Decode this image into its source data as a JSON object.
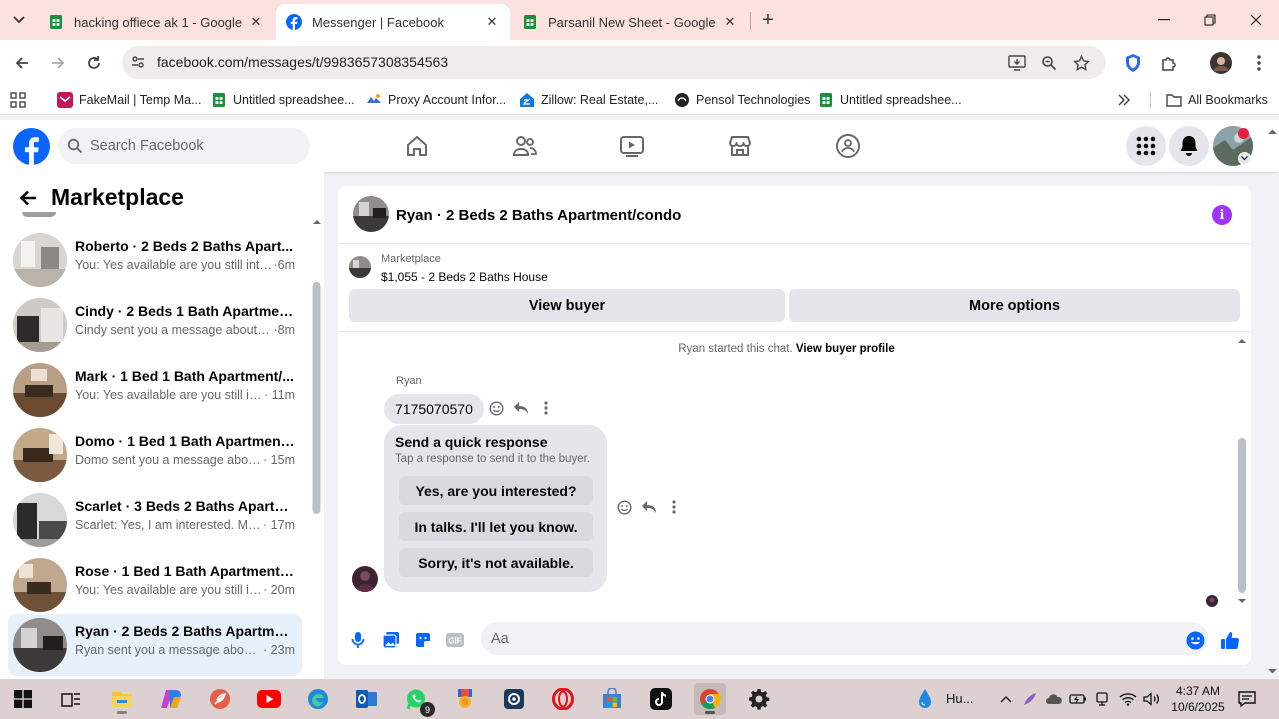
{
  "browser": {
    "tabs": [
      {
        "title": "hacking offiece ak 1 - Google Sh",
        "icon": "google-sheets-icon"
      },
      {
        "title": "Messenger | Facebook",
        "icon": "facebook-icon",
        "active": true
      },
      {
        "title": "Parsanil New Sheet - Google Sh",
        "icon": "google-sheets-icon"
      }
    ],
    "url": "facebook.com/messages/t/9983657308354563",
    "bookmarks": [
      {
        "label": "FakeMail | Temp Ma...",
        "icon": "fakemail-icon"
      },
      {
        "label": "Untitled spreadshee...",
        "icon": "google-sheets-icon"
      },
      {
        "label": "Proxy Account Infor...",
        "icon": "proxy-icon"
      },
      {
        "label": "Zillow: Real Estate,...",
        "icon": "zillow-icon"
      },
      {
        "label": "Pensol Technologies",
        "icon": "pensol-icon"
      },
      {
        "label": "Untitled spreadshee...",
        "icon": "google-sheets-icon"
      }
    ],
    "all_bookmarks": "All Bookmarks"
  },
  "facebook": {
    "search_placeholder": "Search Facebook"
  },
  "marketplace": {
    "title": "Marketplace",
    "conversations": [
      {
        "name": "Roberto · 2 Beds 2 Baths Apart...",
        "preview": "You: Yes available are you still inter...",
        "time": "·6m"
      },
      {
        "name": "Cindy · 2 Beds 1 Bath Apartment...",
        "preview": "Cindy sent you a message about y...",
        "time": "·8m"
      },
      {
        "name": "Mark · 1 Bed 1 Bath Apartment/...",
        "preview": "You: Yes available are you still int...",
        "time": "· 11m"
      },
      {
        "name": "Domo · 1 Bed 1 Bath Apartment...",
        "preview": "Domo sent you a message about...",
        "time": "· 15m"
      },
      {
        "name": "Scarlet · 3 Beds 2 Baths Apartm...",
        "preview": "Scarlet: Yes, I am interested. My n...",
        "time": "· 17m"
      },
      {
        "name": "Rose · 1 Bed 1 Bath Apartment/c...",
        "preview": "You: Yes available are you still int...",
        "time": "· 20m"
      },
      {
        "name": "Ryan · 2 Beds 2 Baths Apartmen...",
        "preview": "Ryan sent you a message about ...",
        "time": "· 23m",
        "active": true
      }
    ]
  },
  "chat": {
    "title": "Ryan · 2 Beds 2 Baths Apartment/condo",
    "listing_kind": "Marketplace",
    "listing_price": "$1,055 - 2 Beds 2 Baths House",
    "view_buyer": "View buyer",
    "more_options": "More options",
    "started_text": "Ryan started this chat.",
    "view_buyer_profile": "View buyer profile",
    "sender": "Ryan",
    "message": "7175070570",
    "quick_response_title": "Send a quick response",
    "quick_response_subtitle": "Tap a response to send it to the buyer.",
    "quick_responses": [
      "Yes, are you interested?",
      "In talks. I'll let you know.",
      "Sorry, it's not available."
    ],
    "composer_placeholder": "Aa"
  },
  "taskbar": {
    "weather": "Hu...",
    "time": "4:37 AM",
    "date": "10/6/2025",
    "whatsapp_badge": "9"
  },
  "colors": {
    "facebook_blue": "#0866ff",
    "messenger_purple": "#a033ff",
    "tabstrip": "#fbe1df",
    "sheets_green": "#1e8e3e"
  }
}
